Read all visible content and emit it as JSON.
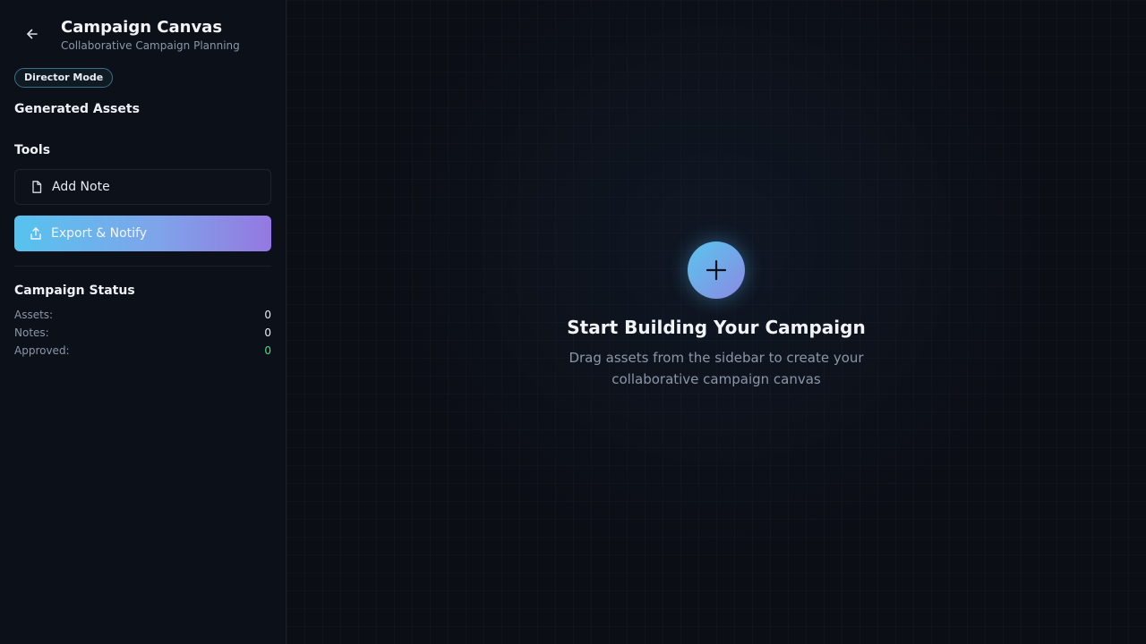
{
  "header": {
    "title": "Campaign Canvas",
    "subtitle": "Collaborative Campaign Planning",
    "back_icon": "arrow-left-icon"
  },
  "mode_badge": "Director Mode",
  "sidebar": {
    "assets_title": "Generated Assets",
    "tools_title": "Tools",
    "tools": {
      "add_note_label": "Add Note",
      "add_note_icon": "note-icon",
      "export_label": "Export & Notify",
      "export_icon": "share-icon"
    },
    "status": {
      "title": "Campaign Status",
      "rows": [
        {
          "label": "Assets:",
          "value": "0"
        },
        {
          "label": "Notes:",
          "value": "0"
        },
        {
          "label": "Approved:",
          "value": "0"
        }
      ]
    }
  },
  "canvas": {
    "add_icon": "plus-icon",
    "empty_title": "Start Building Your Campaign",
    "empty_description": "Drag assets from the sidebar to create your collaborative campaign canvas"
  },
  "colors": {
    "background": "#0b0e14",
    "accent_start": "#56c3ee",
    "accent_end": "#9478e0",
    "approved": "#4ade80"
  }
}
